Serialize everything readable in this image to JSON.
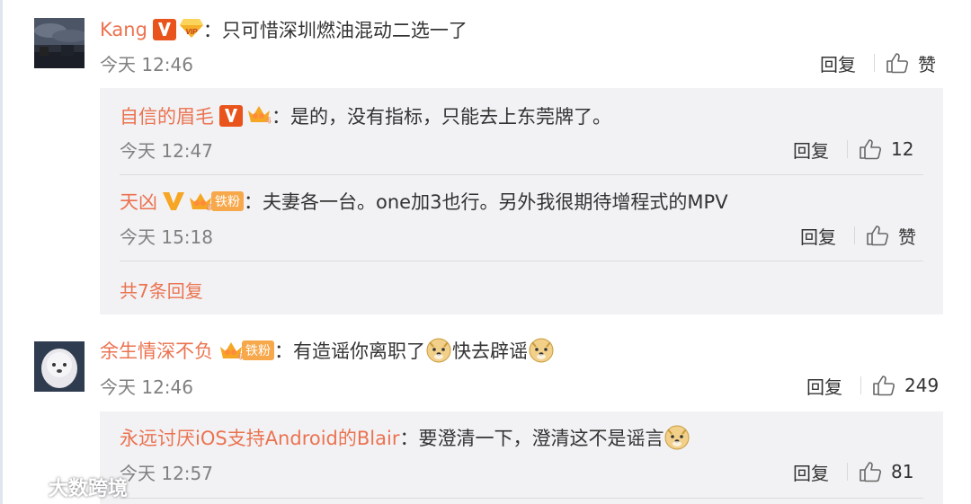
{
  "colors": {
    "name": "#eb7350",
    "text": "#333333",
    "time": "#808080",
    "reply_bg": "#f2f2f5"
  },
  "comments": [
    {
      "user": "Kang",
      "badges": [
        "verified-v-icon",
        "vip-diamond-icon"
      ],
      "text": "：只可惜深圳燃油混动二选一了",
      "time": "今天 12:46",
      "reply_label": "回复",
      "like_label": "赞"
    },
    {
      "user": "余生情深不负",
      "badges": [
        "fan-level-4-icon",
        "铁粉"
      ],
      "text_a": "：有造谣你离职了",
      "text_b": "快去辟谣",
      "time": "今天 12:46",
      "reply_label": "回复",
      "like_count": "249"
    }
  ],
  "replies_1": [
    {
      "user": "自信的眉毛",
      "text": "：是的，没有指标，只能去上东莞牌了。",
      "time": "今天 12:47",
      "reply_label": "回复",
      "like_count": "12"
    },
    {
      "user": "天凶",
      "fan_tag": "铁粉",
      "text": "：夫妻各一台。one加3也行。另外我很期待增程式的MPV",
      "time": "今天 15:18",
      "reply_label": "回复",
      "like_label": "赞"
    }
  ],
  "more_replies": "共7条回复",
  "replies_2": [
    {
      "user": "永远讨厌iOS支持Android的Blair",
      "text": "：要澄清一下，澄清这不是谣言",
      "time": "今天 12:57",
      "reply_label": "回复",
      "like_count": "81"
    }
  ],
  "watermark": "大数跨境"
}
